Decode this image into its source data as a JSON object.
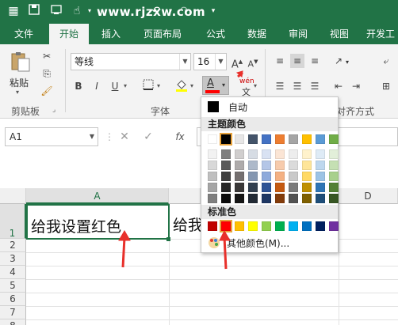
{
  "watermark": "www.rjzxw.com",
  "tabs": [
    "文件",
    "开始",
    "插入",
    "页面布局",
    "公式",
    "数据",
    "审阅",
    "视图",
    "开发工"
  ],
  "ribbon": {
    "paste_label": "粘贴",
    "clipboard_label": "剪贴板",
    "font_group_label": "字体",
    "align_group_label": "对齐方式",
    "font_name": "等线",
    "font_size": "16",
    "bold": "B",
    "italic": "I",
    "underline": "U",
    "font_color_btn": "A",
    "wen": "wén",
    "wen2": "文"
  },
  "formula_bar": {
    "name_box": "A1",
    "cancel": "✕",
    "enter": "✓",
    "fx": "fx"
  },
  "grid": {
    "columns": [
      "A",
      "D"
    ],
    "rows": [
      "1",
      "2",
      "3",
      "4",
      "5",
      "6",
      "7",
      "8"
    ],
    "cell_a1": "给我设置红色",
    "cell_b1": "给我"
  },
  "color_picker": {
    "auto_label": "自动",
    "theme_label": "主题颜色",
    "standard_label": "标准色",
    "more_label": "其他颜色(M)...",
    "theme_top": [
      "#ffffff",
      "#000000",
      "#e7e6e6",
      "#44546a",
      "#4472c4",
      "#ed7d31",
      "#a5a5a5",
      "#ffc000",
      "#5b9bd5",
      "#70ad47"
    ],
    "theme_shades": [
      [
        "#f2f2f2",
        "#7f7f7f",
        "#d0cece",
        "#d6dce4",
        "#d9e2f3",
        "#fbe5d5",
        "#ededed",
        "#fff2cc",
        "#deebf6",
        "#e2efd9"
      ],
      [
        "#d8d8d8",
        "#595959",
        "#aeabab",
        "#adb9ca",
        "#b4c6e7",
        "#f7cbac",
        "#dbdbdb",
        "#fee599",
        "#bdd7ee",
        "#c5e0b3"
      ],
      [
        "#bfbfbf",
        "#3f3f3f",
        "#757070",
        "#8496b0",
        "#8eaadb",
        "#f4b183",
        "#c9c9c9",
        "#ffd965",
        "#9cc3e5",
        "#a8d08d"
      ],
      [
        "#a5a5a5",
        "#262626",
        "#3a3838",
        "#323f4f",
        "#2f5496",
        "#c55a11",
        "#7b7b7b",
        "#bf9000",
        "#2e75b5",
        "#538135"
      ],
      [
        "#7f7f7f",
        "#0c0c0c",
        "#161616",
        "#222a35",
        "#1f3864",
        "#833c0b",
        "#525252",
        "#7f6000",
        "#1e4e79",
        "#375623"
      ]
    ],
    "standard": [
      "#c00000",
      "#ff0000",
      "#ffc000",
      "#ffff00",
      "#92d050",
      "#00b050",
      "#00b0f0",
      "#0070c0",
      "#002060",
      "#7030a0"
    ]
  },
  "colors": {
    "excel_green": "#217346",
    "font_red": "#ff0000",
    "annotation_red": "#e8302b"
  }
}
